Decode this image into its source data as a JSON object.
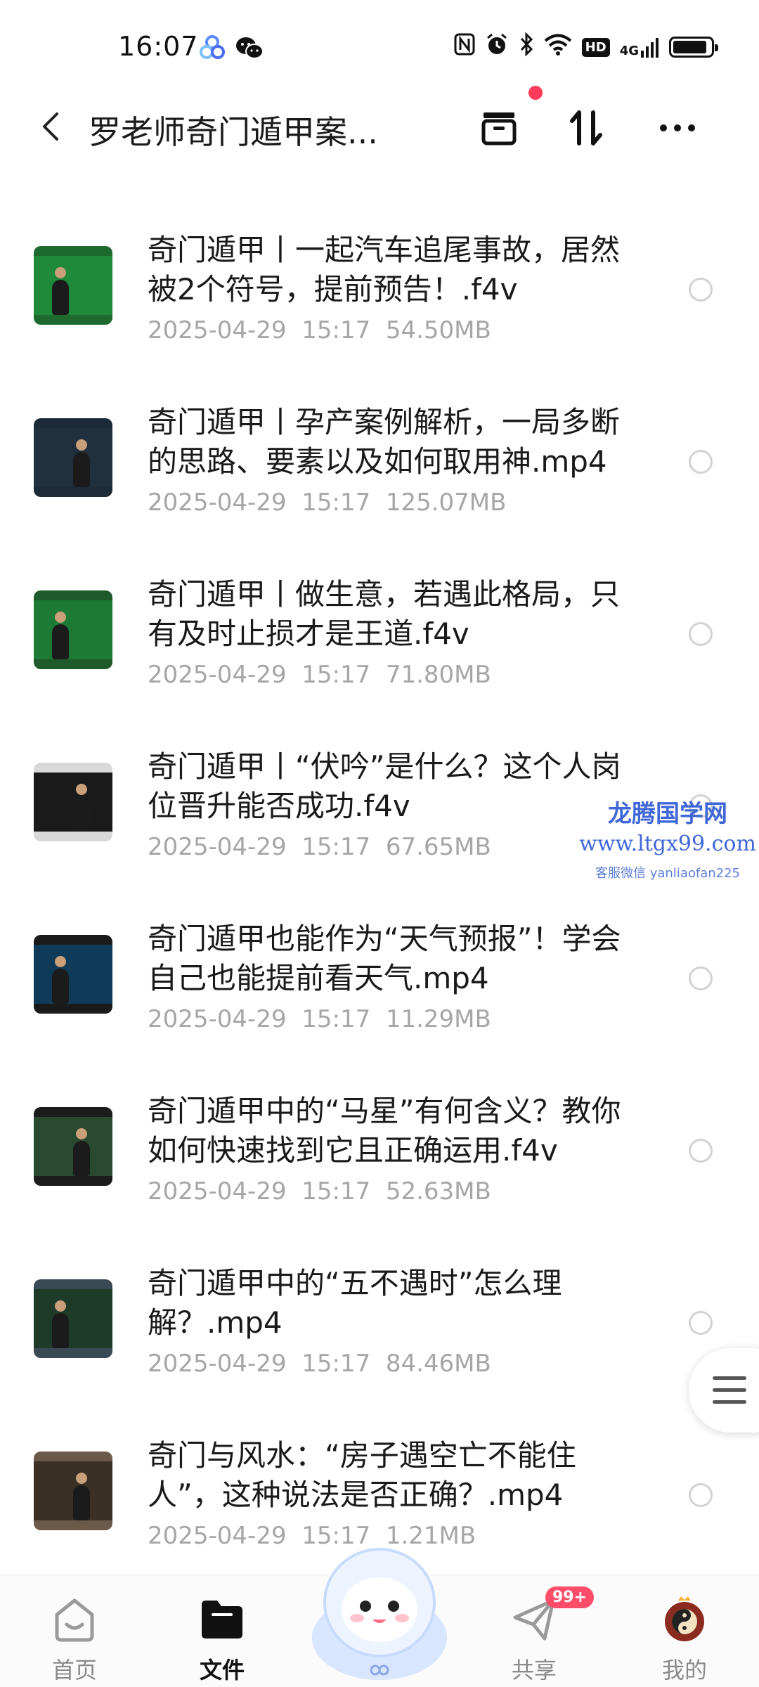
{
  "status_bar": {
    "time": "16:07",
    "network_label": "4G",
    "hd_label": "HD",
    "battery_level": 0.9,
    "icons": [
      "app-logo-icon",
      "wechat-icon",
      "nfc-icon",
      "alarm-icon",
      "bluetooth-icon",
      "wifi-icon",
      "hd-icon",
      "signal-icon",
      "battery-icon"
    ]
  },
  "header": {
    "title": "罗老师奇门遁甲案...",
    "icons": [
      "back-icon",
      "archive-box-icon",
      "sort-icon",
      "more-icon"
    ],
    "dot_color": "#ff3b5c"
  },
  "files": [
    {
      "title": "奇门遁甲丨一起汽车追尾事故，居然被2个符号，提前预告！.f4v",
      "date": "2025-04-29",
      "time": "15:17",
      "size": "54.50MB"
    },
    {
      "title": "奇门遁甲丨孕产案例解析，一局多断的思路、要素以及如何取用神.mp4",
      "date": "2025-04-29",
      "time": "15:17",
      "size": "125.07MB"
    },
    {
      "title": "奇门遁甲丨做生意，若遇此格局，只有及时止损才是王道.f4v",
      "date": "2025-04-29",
      "time": "15:17",
      "size": "71.80MB"
    },
    {
      "title": "奇门遁甲丨“伏吟”是什么？这个人岗位晋升能否成功.f4v",
      "date": "2025-04-29",
      "time": "15:17",
      "size": "67.65MB"
    },
    {
      "title": "奇门遁甲也能作为“天气预报”！学会自己也能提前看天气.mp4",
      "date": "2025-04-29",
      "time": "15:17",
      "size": "11.29MB"
    },
    {
      "title": "奇门遁甲中的“马星”有何含义？教你如何快速找到它且正确运用.f4v",
      "date": "2025-04-29",
      "time": "15:17",
      "size": "52.63MB"
    },
    {
      "title": "奇门遁甲中的“五不遇时”怎么理解？.mp4",
      "date": "2025-04-29",
      "time": "15:17",
      "size": "84.46MB"
    },
    {
      "title": "奇门与风水：“房子遇空亡不能住人”，这种说法是否正确？.mp4",
      "date": "2025-04-29",
      "time": "15:17",
      "size": "1.21MB"
    }
  ],
  "watermark": {
    "brand": "龙腾国学网",
    "url": "www.ltgx99.com",
    "wechat": "客服微信 yanliaofan225",
    "color": "#3f67d8"
  },
  "nav": {
    "items": [
      {
        "label": "首页",
        "icon": "home-icon",
        "active": false
      },
      {
        "label": "文件",
        "icon": "folder-icon",
        "active": true
      },
      {
        "label": "共享",
        "icon": "paper-plane-icon",
        "active": false,
        "badge": "99+"
      },
      {
        "label": "我的",
        "icon": "avatar-icon",
        "active": false
      }
    ],
    "badge_color": "#ff4d6a"
  }
}
